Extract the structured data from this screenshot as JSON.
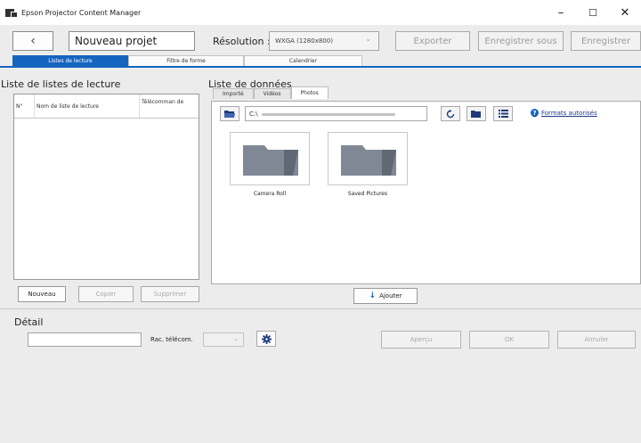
{
  "window": {
    "title": "Epson Projector Content Manager",
    "minimize": "–",
    "maximize": "☐",
    "close": "✕"
  },
  "toolbar": {
    "back": "‹",
    "project_name": "Nouveau projet",
    "resolution_label": "Résolution :",
    "resolution_value": "WXGA (1280x800)",
    "export": "Exporter",
    "save_as": "Enregistrer sous",
    "save": "Enregistrer"
  },
  "main_tabs": [
    {
      "label": "Listes de lecture",
      "active": true
    },
    {
      "label": "Filtre de forme",
      "active": false
    },
    {
      "label": "Calendrier",
      "active": false
    }
  ],
  "playlists": {
    "title": "Liste de listes de lecture",
    "columns": [
      "N°",
      "Nom de liste de lecture",
      "Télécomman de"
    ],
    "rows": [],
    "buttons": {
      "new": "Nouveau",
      "copy": "Copier",
      "delete": "Supprimer"
    }
  },
  "data_list": {
    "title": "Liste de données",
    "tabs": [
      {
        "label": "Importé",
        "active": false
      },
      {
        "label": "Vidéos",
        "active": false
      },
      {
        "label": "Photos",
        "active": true
      }
    ],
    "path": "C:\\",
    "formats_link": "Formats autorisés",
    "help_mark": "?",
    "folders": [
      "Camera Roll",
      "Saved Pictures"
    ],
    "add_button": "Ajouter",
    "add_icon": "↓"
  },
  "detail": {
    "title": "Détail",
    "remote_label": "Rac. télécom.",
    "preview": "Aperçu",
    "ok": "OK",
    "cancel": "Annuler"
  },
  "colors": {
    "accent": "#1565c0",
    "folder": "#7f8894",
    "link": "#1a3a8a"
  }
}
